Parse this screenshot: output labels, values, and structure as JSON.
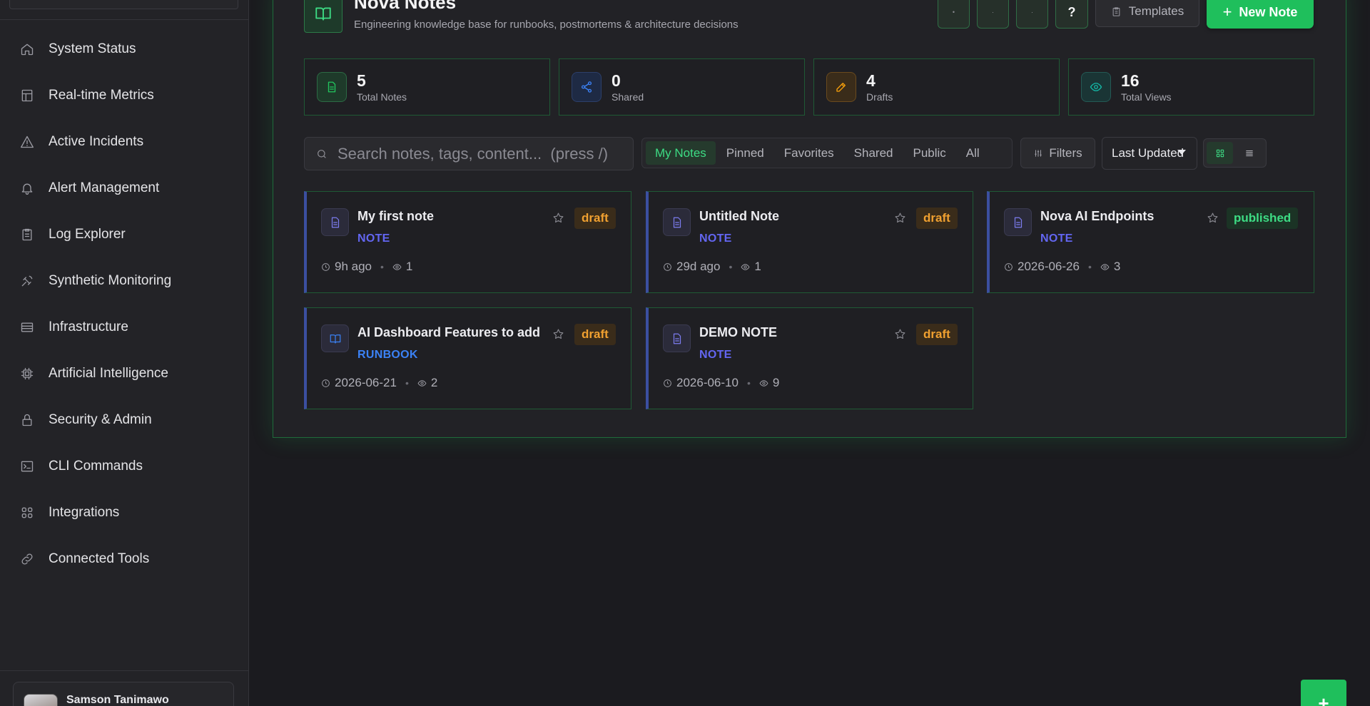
{
  "sidebar": {
    "items": [
      {
        "label": "System Status",
        "icon": "home-icon"
      },
      {
        "label": "Real-time Metrics",
        "icon": "layout-icon"
      },
      {
        "label": "Active Incidents",
        "icon": "alert-triangle-icon"
      },
      {
        "label": "Alert Management",
        "icon": "bell-icon"
      },
      {
        "label": "Log Explorer",
        "icon": "clipboard-icon"
      },
      {
        "label": "Synthetic Monitoring",
        "icon": "satellite-icon"
      },
      {
        "label": "Infrastructure",
        "icon": "server-icon"
      },
      {
        "label": "Artificial Intelligence",
        "icon": "cpu-icon"
      },
      {
        "label": "Security & Admin",
        "icon": "lock-icon"
      },
      {
        "label": "CLI Commands",
        "icon": "terminal-icon"
      },
      {
        "label": "Integrations",
        "icon": "grid-icon"
      },
      {
        "label": "Connected Tools",
        "icon": "link-icon"
      }
    ],
    "user": {
      "name": "Samson Tanimawo"
    }
  },
  "header": {
    "title": "Nova Notes",
    "subtitle": "Engineering knowledge base for runbooks, postmortems & architecture decisions",
    "help_label": "?",
    "templates_label": "Templates",
    "new_note_label": "New Note"
  },
  "stats": [
    {
      "value": "5",
      "label": "Total Notes",
      "icon": "file-icon",
      "color": "#22c55e"
    },
    {
      "value": "0",
      "label": "Shared",
      "icon": "share-icon",
      "color": "#3b82f6"
    },
    {
      "value": "4",
      "label": "Drafts",
      "icon": "edit-icon",
      "color": "#f59e0b"
    },
    {
      "value": "16",
      "label": "Total Views",
      "icon": "eye-icon",
      "color": "#14b8a6"
    }
  ],
  "toolbar": {
    "search_placeholder": "Search notes, tags, content...  (press /)",
    "tabs": [
      "My Notes",
      "Pinned",
      "Favorites",
      "Shared",
      "Public",
      "All"
    ],
    "active_tab": "My Notes",
    "filters_label": "Filters",
    "sort_value": "Last Updated",
    "view_mode": "grid"
  },
  "notes": [
    {
      "title": "My first note",
      "type": "NOTE",
      "status": "draft",
      "updated": "9h ago",
      "views": "1",
      "icon": "file-icon"
    },
    {
      "title": "Untitled Note",
      "type": "NOTE",
      "status": "draft",
      "updated": "29d ago",
      "views": "1",
      "icon": "file-icon"
    },
    {
      "title": "Nova AI Endpoints",
      "type": "NOTE",
      "status": "published",
      "updated": "2026-06-26",
      "views": "3",
      "icon": "file-icon"
    },
    {
      "title": "AI Dashboard Features to add",
      "type": "RUNBOOK",
      "status": "draft",
      "updated": "2026-06-21",
      "views": "2",
      "icon": "book-icon"
    },
    {
      "title": "DEMO NOTE",
      "type": "NOTE",
      "status": "draft",
      "updated": "2026-06-10",
      "views": "9",
      "icon": "file-icon"
    }
  ],
  "colors": {
    "accent": "#22c55e",
    "note_type": "#6366f1",
    "runbook_type": "#3b82f6",
    "draft": "#f59e0b",
    "published": "#22c55e"
  },
  "fab_label": "+"
}
